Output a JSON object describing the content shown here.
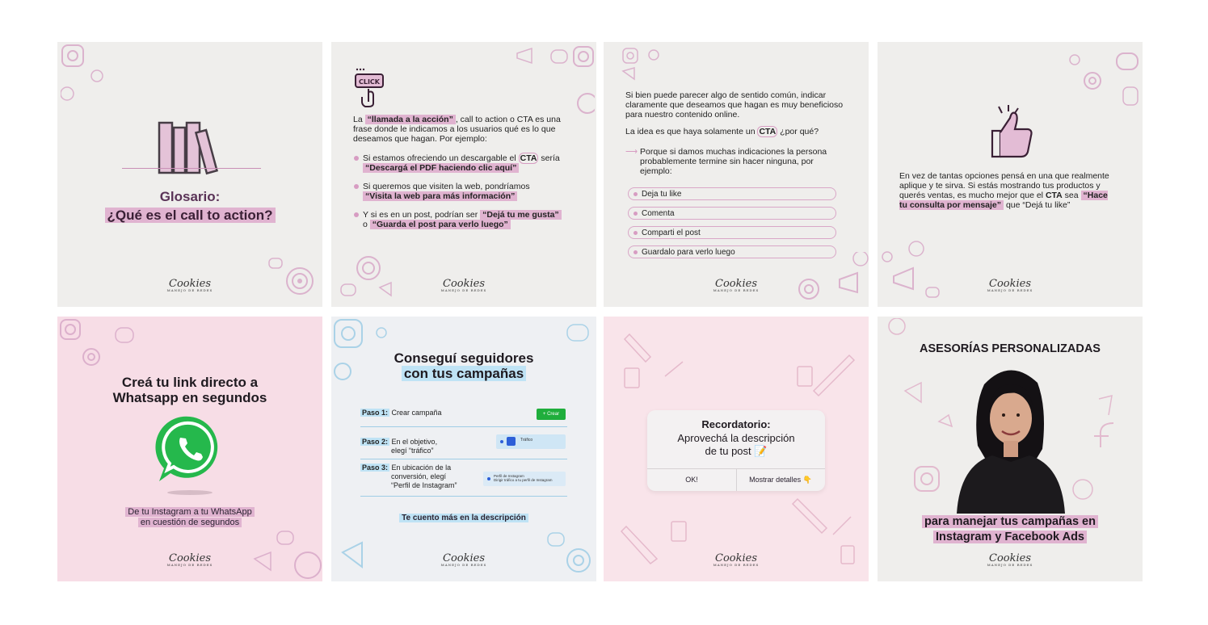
{
  "brand": {
    "logo": "Cookies",
    "tagline": "MANEJO DE REDES"
  },
  "card1": {
    "title_line1": "Glosario:",
    "title_line2": "¿Qué es el call to action?"
  },
  "card2": {
    "click_badge": "CLICK",
    "intro_pre": "La ",
    "intro_hl": "“llamada a la acción”",
    "intro_post": ", call to action o CTA es una frase donde le indicamos a los usuarios qué es lo que deseamos que hagan. Por ejemplo:",
    "b1_pre": "Si estamos ofreciendo un descargable el ",
    "b1_cta": "CTA",
    "b1_post": " sería",
    "b1_hl": "“Descargá el PDF haciendo clic aquí”",
    "b2_pre": "Si queremos que visiten la web, pondríamos",
    "b2_hl": "“Visita la web para más información”",
    "b3_pre": "Y si es en un post, podrían ser ",
    "b3_hl1": "“Dejá tu me gusta”",
    "b3_mid": "o ",
    "b3_hl2": "“Guarda el post para verlo luego”"
  },
  "card3": {
    "p1": "Si bien puede parecer algo de sentido común, indicar claramente que deseamos que hagan es muy beneficioso para nuestro contenido online.",
    "p2_pre": "La idea es que haya solamente un ",
    "p2_cta": "CTA",
    "p2_post": " ¿por qué?",
    "p3": "Porque si damos muchas indicaciones la persona probablemente termine sin hacer ninguna, por ejemplo:",
    "pills": [
      "Deja tu like",
      "Comenta",
      "Comparti el post",
      "Guardalo para verlo luego"
    ]
  },
  "card4": {
    "p_pre": "En vez de tantas opciones pensá en una que realmente aplique y te sirva. Si estás mostrando tus productos y querés ventas, es mucho mejor que el ",
    "p_cta": "CTA",
    "p_mid": " sea ",
    "p_hl": "“Hace tu consulta por mensaje”",
    "p_post": " que “Dejá tu like”"
  },
  "card5": {
    "title_line1": "Creá tu link directo a",
    "title_line2": "Whatsapp en segundos",
    "sub_line1": "De tu Instagram a tu WhatsApp",
    "sub_line2": "en cuestión de segundos"
  },
  "card6": {
    "title_line1": "Conseguí seguidores",
    "title_line2": "con tus campañas",
    "step1_label": "Paso 1:",
    "step1_text": "Crear campaña",
    "step1_button": "+ Crear",
    "step2_label": "Paso 2:",
    "step2_text1": "En el objetivo,",
    "step2_text2": "elegí “tráfico”",
    "step2_ui": "Tráfico",
    "step3_label": "Paso 3:",
    "step3_text1": "En ubicación de la",
    "step3_text2": "conversión, elegí",
    "step3_text3": "“Perfil de Instagram”",
    "step3_ui1": "Perfil de Instagram",
    "step3_ui2": "Dirigir tráfico a tu perfil de Instagram",
    "footer": "Te cuento más en la descripción"
  },
  "card7": {
    "title": "Recordatorio:",
    "line1": "Aprovechá la descripción",
    "line2": "de tu post 📝",
    "btn_ok": "OK!",
    "btn_details": "Mostrar detalles 👇"
  },
  "card8": {
    "title": "ASESORÍAS PERSONALIZADAS",
    "sub_line1": "para manejar tus campañas en",
    "sub_line2": "Instagram y Facebook Ads"
  },
  "colors": {
    "pink_accent": "#d79cc2",
    "purple_title": "#5a3357",
    "whatsapp_green": "#25b84c",
    "blue_highlight": "#bfe3f5"
  }
}
